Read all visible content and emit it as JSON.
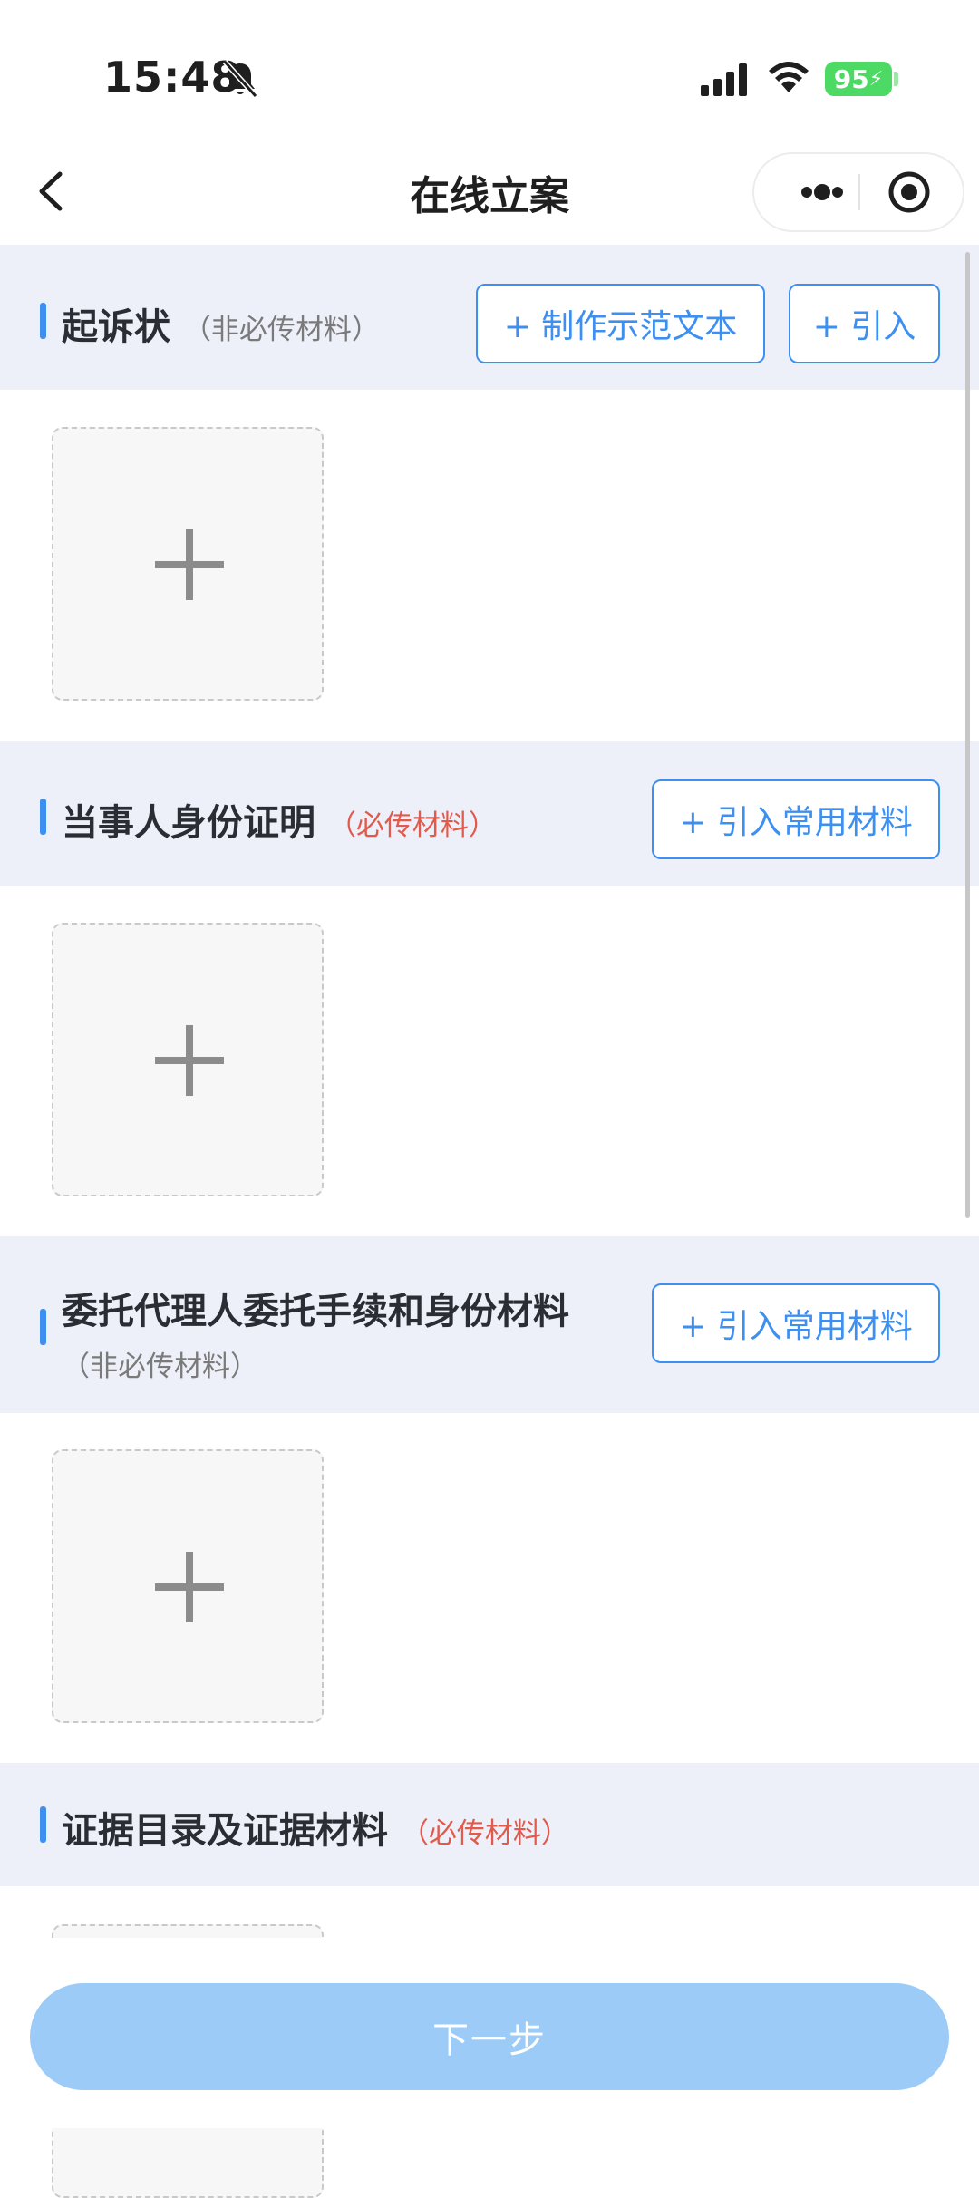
{
  "status_bar": {
    "time": "15:48",
    "battery": "95",
    "icons": [
      "bell-slash-icon",
      "cellular-signal-icon",
      "wifi-icon",
      "battery-charging-icon"
    ]
  },
  "nav": {
    "title": "在线立案",
    "back_icon": "chevron-left-icon",
    "more_icon": "more-dots-icon",
    "record_icon": "record-circle-icon"
  },
  "sections": [
    {
      "title": "起诉状",
      "note": "（非必传材料）",
      "note_color": "#7a7a7a",
      "buttons": [
        "+ 制作示范文本",
        "+ 引入"
      ]
    },
    {
      "title": "当事人身份证明",
      "note": "（必传材料）",
      "note_color": "#e25a4c",
      "buttons": [
        "+ 引入常用材料"
      ]
    },
    {
      "title": "委托代理人委托手续和身份材料",
      "note": "（非必传材料）",
      "note_color": "#7a7a7a",
      "buttons": [
        "+ 引入常用材料"
      ]
    },
    {
      "title": "证据目录及证据材料",
      "note": "（必传材料）",
      "note_color": "#e25a4c",
      "buttons": []
    }
  ],
  "upload_icon": "plus-icon",
  "footer": {
    "next_label": "下一步"
  },
  "colors": {
    "accent": "#3d8ff0",
    "section_bg": "#edf0f8",
    "required": "#e25a4c",
    "next_button_bg": "#9ccbf7",
    "battery": "#4cd964"
  }
}
